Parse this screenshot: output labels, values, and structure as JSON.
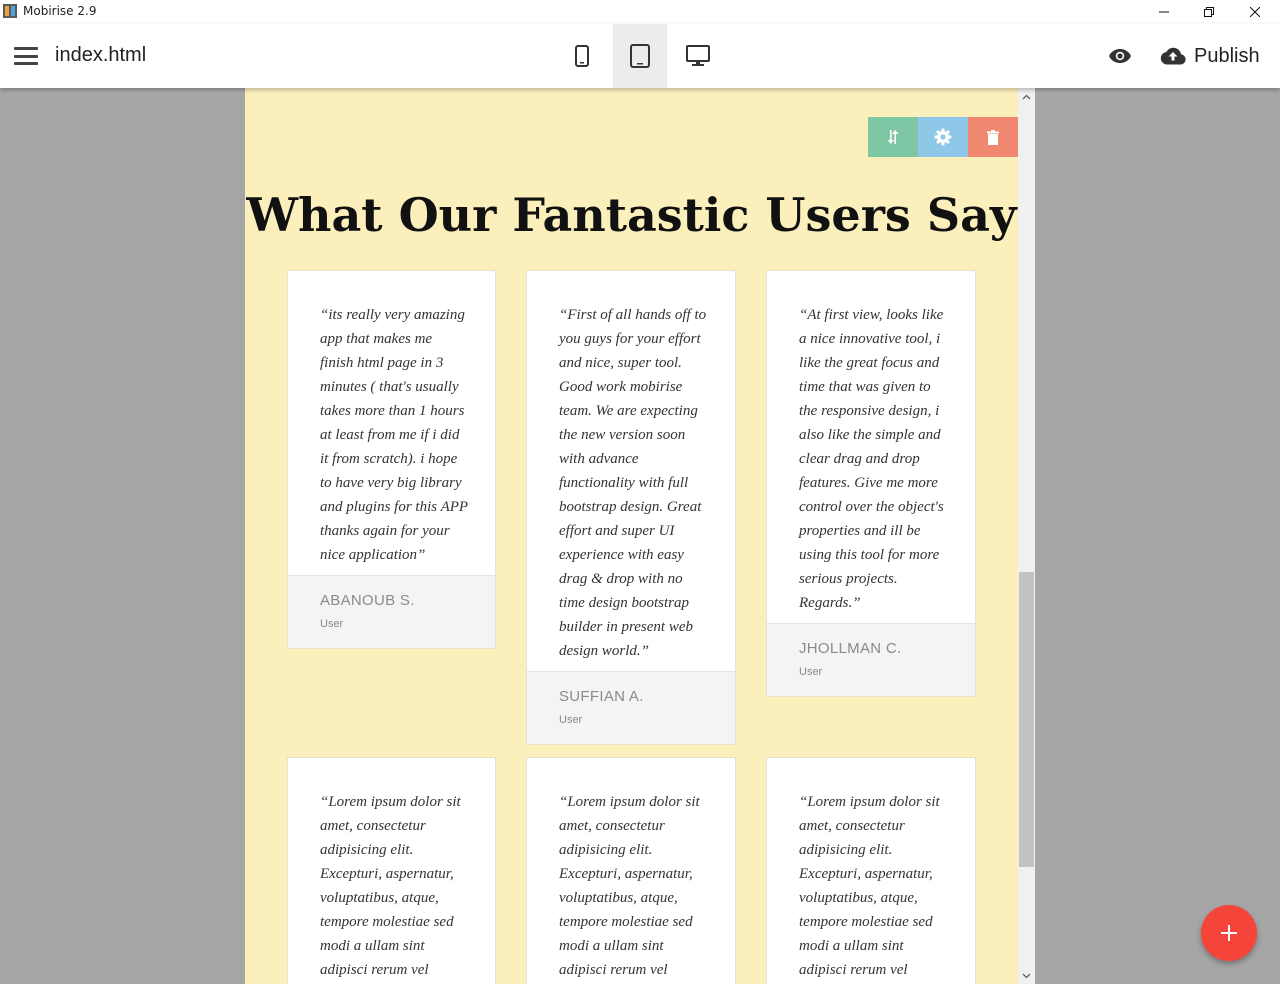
{
  "window": {
    "title": "Mobirise 2.9",
    "controls": [
      "minimize-icon",
      "restore-icon",
      "close-icon"
    ]
  },
  "toolbar": {
    "filename": "index.html",
    "devices": [
      {
        "name": "mobile",
        "icon": "phone-icon",
        "active": false
      },
      {
        "name": "tablet",
        "icon": "tablet-icon",
        "active": true
      },
      {
        "name": "desktop",
        "icon": "monitor-icon",
        "active": false
      }
    ],
    "preview_icon": "eye-icon",
    "publish_label": "Publish",
    "publish_icon": "cloud-upload-icon"
  },
  "block_tools": {
    "icons": [
      "move-icon",
      "gear-icon",
      "trash-icon"
    ],
    "colors": {
      "move": "#7fc6a4",
      "settings": "#8ec8e8",
      "delete": "#f0876f"
    }
  },
  "section": {
    "title": "What Our Fantastic Users Say",
    "background": "#fbefbc",
    "testimonials": [
      {
        "quote": "“its really very amazing app that makes me finish html page in 3 minutes ( that's usually takes more than 1 hours at least from me if i did it from scratch). i hope to have very big library and plugins for this APP thanks again for your nice application”",
        "name": "ABANOUB S.",
        "role": "User"
      },
      {
        "quote": "“First of all hands off to you guys for your effort and nice, super tool. Good work mobirise team. We are expecting the new version soon with advance functionality with full bootstrap design. Great effort and super UI experience with easy drag & drop with no time design bootstrap builder in present web design world.”",
        "name": "SUFFIAN A.",
        "role": "User"
      },
      {
        "quote": "“At first view, looks like a nice innovative tool, i like the great focus and time that was given to the responsive design, i also like the simple and clear drag and drop features. Give me more control over the object's properties and ill be using this tool for more serious projects. Regards.”",
        "name": "JHOLLMAN C.",
        "role": "User"
      },
      {
        "quote": "“Lorem ipsum dolor sit amet, consectetur adipisicing elit. Excepturi, aspernatur, voluptatibus, atque, tempore molestiae sed modi a ullam sint adipisci rerum vel praesentium",
        "name": "",
        "role": ""
      },
      {
        "quote": "“Lorem ipsum dolor sit amet, consectetur adipisicing elit. Excepturi, aspernatur, voluptatibus, atque, tempore molestiae sed modi a ullam sint adipisci rerum vel praesentium",
        "name": "",
        "role": ""
      },
      {
        "quote": "“Lorem ipsum dolor sit amet, consectetur adipisicing elit. Excepturi, aspernatur, voluptatibus, atque, tempore molestiae sed modi a ullam sint adipisci rerum vel praesentium",
        "name": "",
        "role": ""
      }
    ]
  },
  "fab": {
    "icon": "plus-icon",
    "color": "#f5443a"
  }
}
